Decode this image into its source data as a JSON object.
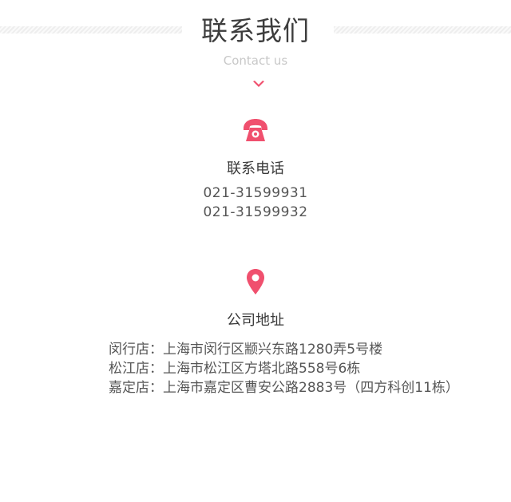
{
  "header": {
    "title": "联系我们",
    "subtitle": "Contact us"
  },
  "colors": {
    "accent": "#f0506e",
    "text": "#444444",
    "muted": "#c8c8c8"
  },
  "phone": {
    "icon": "telephone-icon",
    "title": "联系电话",
    "numbers": [
      "021-31599931",
      "021-31599932"
    ]
  },
  "address": {
    "icon": "location-pin-icon",
    "title": "公司地址",
    "stores": [
      "闵行店：上海市闵行区颛兴东路1280弄5号楼",
      "松江店：上海市松江区方塔北路558号6栋",
      "嘉定店：上海市嘉定区曹安公路2883号（四方科创11栋）"
    ]
  }
}
